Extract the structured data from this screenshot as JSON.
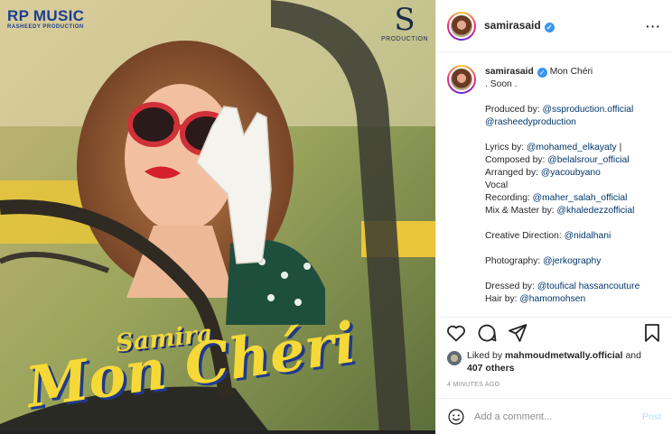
{
  "poster": {
    "brand_left": "RP MUSIC",
    "brand_left_sub": "RASHEEDY PRODUCTION",
    "brand_right_mark": "S",
    "brand_right_sub": "PRODUCTION",
    "artist": "Samira",
    "song": "Mon Chéri"
  },
  "header": {
    "username": "samirasaid",
    "verified_icon": "verified-badge-icon",
    "more_icon": "more-options-icon",
    "more_glyph": "···"
  },
  "caption": {
    "username": "samirasaid",
    "lines": [
      {
        "text": "Mon Chéri",
        "links": []
      },
      {
        "text": ". Soon ."
      },
      {
        "gap": true
      },
      {
        "prefix": "Produced by: ",
        "link": "@ssproduction.official"
      },
      {
        "link": "@rasheedyproduction"
      },
      {
        "gap": true
      },
      {
        "prefix": "Lyrics by: ",
        "link": "@mohamed_elkayaty",
        "suffix": "  |"
      },
      {
        "prefix": "Composed by: ",
        "link": "@belalsrour_official"
      },
      {
        "prefix": "Arranged by: ",
        "link": "@yacoubyano"
      },
      {
        "text": "Vocal"
      },
      {
        "prefix": "Recording: ",
        "link": "@maher_salah_official"
      },
      {
        "prefix": "Mix & Master by: ",
        "link": "@khaledezzofficial"
      },
      {
        "gap": true
      },
      {
        "prefix": "Creative Direction: ",
        "link": "@nidalhani"
      },
      {
        "gap": true
      },
      {
        "prefix": "Photography: ",
        "link": "@jerkography"
      },
      {
        "gap": true
      },
      {
        "prefix": "Dressed by: ",
        "link": "@toufical hassancouture"
      },
      {
        "prefix": "Hair by: ",
        "link": "@hamomohsen"
      }
    ]
  },
  "actions": {
    "like_icon": "heart-icon",
    "comment_icon": "comment-icon",
    "share_icon": "share-icon",
    "save_icon": "bookmark-icon"
  },
  "likes": {
    "prefix": "Liked by ",
    "user": "mahmoudmetwally.official",
    "middle": " and",
    "count": "407 others"
  },
  "timestamp": "4 MINUTES AGO",
  "comment": {
    "placeholder": "Add a comment...",
    "post_label": "Post",
    "emoji_icon": "emoji-icon"
  },
  "colors": {
    "link": "#00376b",
    "verified": "#3897f0",
    "post_disabled": "#b2dffc",
    "title_yellow": "#f6d936"
  }
}
